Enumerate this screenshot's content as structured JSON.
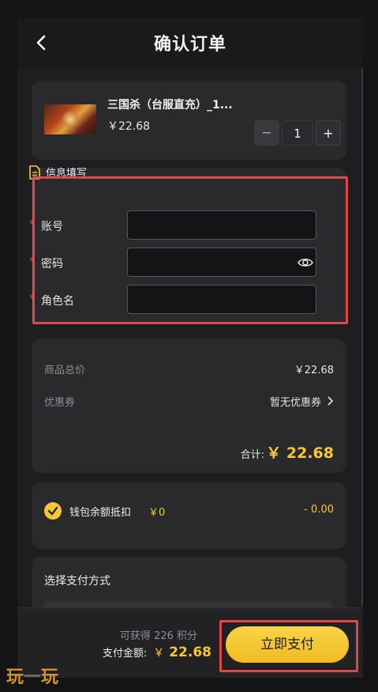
{
  "header": {
    "title": "确认订单"
  },
  "product": {
    "name": "三国杀（台服直充）_1...",
    "price": "￥22.68",
    "quantity": "1",
    "minus": "−",
    "plus": "+"
  },
  "info": {
    "title": "信息填写",
    "required_mark": "*",
    "fields": [
      {
        "label": "账号",
        "value": "",
        "placeholder": ""
      },
      {
        "label": "密码",
        "value": "",
        "placeholder": ""
      },
      {
        "label": "角色名",
        "value": "",
        "placeholder": ""
      }
    ]
  },
  "summary": {
    "goods_total_label": "商品总价",
    "goods_total_value": "￥22.68",
    "coupon_label": "优惠券",
    "coupon_value": "暂无优惠券",
    "total_label": "合计:",
    "total_value": "￥ 22.68"
  },
  "wallet": {
    "label": "钱包余额抵扣",
    "amount": "￥0",
    "deduct": "- 0.00"
  },
  "payment": {
    "title": "选择支付方式"
  },
  "footer": {
    "points_text": "可获得 226 积分",
    "pay_label": "支付金额:",
    "pay_symbol": "￥",
    "pay_value": "22.68",
    "pay_button": "立即支付"
  },
  "colors": {
    "accent": "#f7c833",
    "highlight": "#e0464a",
    "background": "#1e1e21",
    "card": "#2a2a2d"
  },
  "icons": [
    "back-arrow-icon",
    "document-icon",
    "eye-icon",
    "checkmark-circle-icon",
    "chevron-right-icon"
  ]
}
